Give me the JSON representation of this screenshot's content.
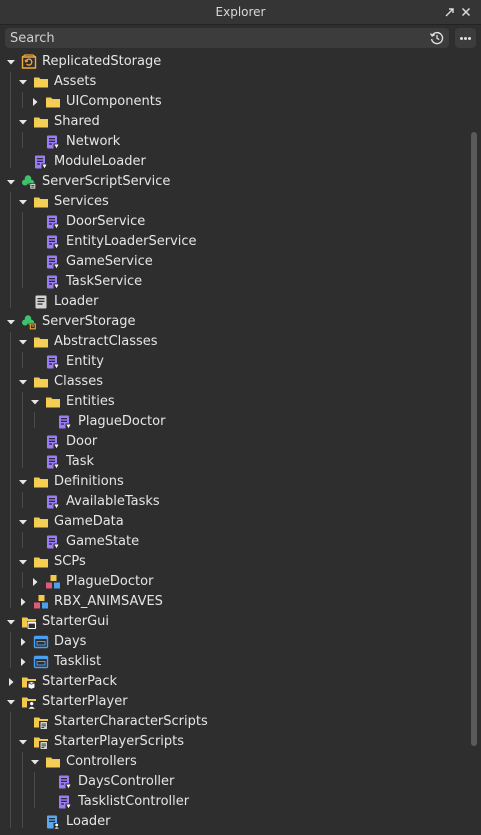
{
  "panel": {
    "title": "Explorer"
  },
  "search": {
    "placeholder": "Search"
  },
  "tree": [
    {
      "label": "ReplicatedStorage",
      "depth": 0,
      "icon": "replicated-storage-icon",
      "expander": "expanded"
    },
    {
      "label": "Assets",
      "depth": 1,
      "icon": "folder-icon",
      "expander": "expanded"
    },
    {
      "label": "UIComponents",
      "depth": 2,
      "icon": "folder-icon",
      "expander": "collapsed"
    },
    {
      "label": "Shared",
      "depth": 1,
      "icon": "folder-icon",
      "expander": "expanded"
    },
    {
      "label": "Network",
      "depth": 2,
      "icon": "module-script-icon",
      "expander": "none"
    },
    {
      "label": "ModuleLoader",
      "depth": 1,
      "icon": "module-script-icon",
      "expander": "none"
    },
    {
      "label": "ServerScriptService",
      "depth": 0,
      "icon": "server-script-service-icon",
      "expander": "expanded"
    },
    {
      "label": "Services",
      "depth": 1,
      "icon": "folder-icon",
      "expander": "expanded"
    },
    {
      "label": "DoorService",
      "depth": 2,
      "icon": "module-script-icon",
      "expander": "none"
    },
    {
      "label": "EntityLoaderService",
      "depth": 2,
      "icon": "module-script-icon",
      "expander": "none"
    },
    {
      "label": "GameService",
      "depth": 2,
      "icon": "module-script-icon",
      "expander": "none"
    },
    {
      "label": "TaskService",
      "depth": 2,
      "icon": "module-script-icon",
      "expander": "none"
    },
    {
      "label": "Loader",
      "depth": 1,
      "icon": "script-icon",
      "expander": "none"
    },
    {
      "label": "ServerStorage",
      "depth": 0,
      "icon": "server-storage-icon",
      "expander": "expanded"
    },
    {
      "label": "AbstractClasses",
      "depth": 1,
      "icon": "folder-icon",
      "expander": "expanded"
    },
    {
      "label": "Entity",
      "depth": 2,
      "icon": "module-script-icon",
      "expander": "none"
    },
    {
      "label": "Classes",
      "depth": 1,
      "icon": "folder-icon",
      "expander": "expanded"
    },
    {
      "label": "Entities",
      "depth": 2,
      "icon": "folder-icon",
      "expander": "expanded"
    },
    {
      "label": "PlagueDoctor",
      "depth": 3,
      "icon": "module-script-icon",
      "expander": "none"
    },
    {
      "label": "Door",
      "depth": 2,
      "icon": "module-script-icon",
      "expander": "none"
    },
    {
      "label": "Task",
      "depth": 2,
      "icon": "module-script-icon",
      "expander": "none"
    },
    {
      "label": "Definitions",
      "depth": 1,
      "icon": "folder-icon",
      "expander": "expanded"
    },
    {
      "label": "AvailableTasks",
      "depth": 2,
      "icon": "module-script-icon",
      "expander": "none"
    },
    {
      "label": "GameData",
      "depth": 1,
      "icon": "folder-icon",
      "expander": "expanded"
    },
    {
      "label": "GameState",
      "depth": 2,
      "icon": "module-script-icon",
      "expander": "none"
    },
    {
      "label": "SCPs",
      "depth": 1,
      "icon": "folder-icon",
      "expander": "expanded"
    },
    {
      "label": "PlagueDoctor",
      "depth": 2,
      "icon": "model-icon",
      "expander": "collapsed"
    },
    {
      "label": "RBX_ANIMSAVES",
      "depth": 1,
      "icon": "model-icon",
      "expander": "collapsed"
    },
    {
      "label": "StarterGui",
      "depth": 0,
      "icon": "starter-gui-icon",
      "expander": "expanded"
    },
    {
      "label": "Days",
      "depth": 1,
      "icon": "screen-gui-icon",
      "expander": "collapsed"
    },
    {
      "label": "Tasklist",
      "depth": 1,
      "icon": "screen-gui-icon",
      "expander": "collapsed"
    },
    {
      "label": "StarterPack",
      "depth": 0,
      "icon": "starter-pack-icon",
      "expander": "collapsed"
    },
    {
      "label": "StarterPlayer",
      "depth": 0,
      "icon": "starter-player-icon",
      "expander": "expanded"
    },
    {
      "label": "StarterCharacterScripts",
      "depth": 1,
      "icon": "starter-scripts-icon",
      "expander": "none"
    },
    {
      "label": "StarterPlayerScripts",
      "depth": 1,
      "icon": "starter-scripts-icon",
      "expander": "expanded"
    },
    {
      "label": "Controllers",
      "depth": 2,
      "icon": "folder-icon",
      "expander": "expanded"
    },
    {
      "label": "DaysController",
      "depth": 3,
      "icon": "module-script-icon",
      "expander": "none"
    },
    {
      "label": "TasklistController",
      "depth": 3,
      "icon": "module-script-icon",
      "expander": "none"
    },
    {
      "label": "Loader",
      "depth": 2,
      "icon": "local-script-icon",
      "expander": "none"
    }
  ]
}
